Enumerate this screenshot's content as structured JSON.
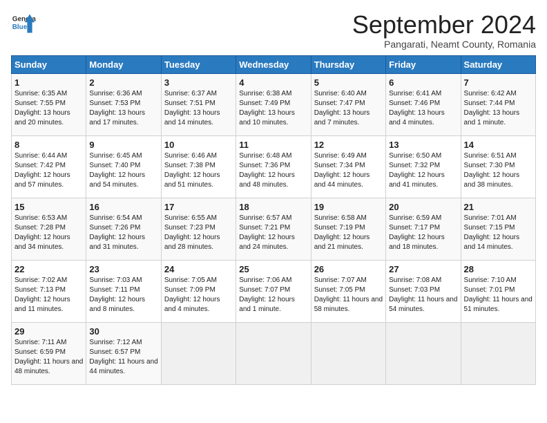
{
  "header": {
    "logo_general": "General",
    "logo_blue": "Blue",
    "month_title": "September 2024",
    "subtitle": "Pangarati, Neamt County, Romania"
  },
  "weekdays": [
    "Sunday",
    "Monday",
    "Tuesday",
    "Wednesday",
    "Thursday",
    "Friday",
    "Saturday"
  ],
  "weeks": [
    [
      {
        "day": "1",
        "info": "Sunrise: 6:35 AM\nSunset: 7:55 PM\nDaylight: 13 hours and 20 minutes."
      },
      {
        "day": "2",
        "info": "Sunrise: 6:36 AM\nSunset: 7:53 PM\nDaylight: 13 hours and 17 minutes."
      },
      {
        "day": "3",
        "info": "Sunrise: 6:37 AM\nSunset: 7:51 PM\nDaylight: 13 hours and 14 minutes."
      },
      {
        "day": "4",
        "info": "Sunrise: 6:38 AM\nSunset: 7:49 PM\nDaylight: 13 hours and 10 minutes."
      },
      {
        "day": "5",
        "info": "Sunrise: 6:40 AM\nSunset: 7:47 PM\nDaylight: 13 hours and 7 minutes."
      },
      {
        "day": "6",
        "info": "Sunrise: 6:41 AM\nSunset: 7:46 PM\nDaylight: 13 hours and 4 minutes."
      },
      {
        "day": "7",
        "info": "Sunrise: 6:42 AM\nSunset: 7:44 PM\nDaylight: 13 hours and 1 minute."
      }
    ],
    [
      {
        "day": "8",
        "info": "Sunrise: 6:44 AM\nSunset: 7:42 PM\nDaylight: 12 hours and 57 minutes."
      },
      {
        "day": "9",
        "info": "Sunrise: 6:45 AM\nSunset: 7:40 PM\nDaylight: 12 hours and 54 minutes."
      },
      {
        "day": "10",
        "info": "Sunrise: 6:46 AM\nSunset: 7:38 PM\nDaylight: 12 hours and 51 minutes."
      },
      {
        "day": "11",
        "info": "Sunrise: 6:48 AM\nSunset: 7:36 PM\nDaylight: 12 hours and 48 minutes."
      },
      {
        "day": "12",
        "info": "Sunrise: 6:49 AM\nSunset: 7:34 PM\nDaylight: 12 hours and 44 minutes."
      },
      {
        "day": "13",
        "info": "Sunrise: 6:50 AM\nSunset: 7:32 PM\nDaylight: 12 hours and 41 minutes."
      },
      {
        "day": "14",
        "info": "Sunrise: 6:51 AM\nSunset: 7:30 PM\nDaylight: 12 hours and 38 minutes."
      }
    ],
    [
      {
        "day": "15",
        "info": "Sunrise: 6:53 AM\nSunset: 7:28 PM\nDaylight: 12 hours and 34 minutes."
      },
      {
        "day": "16",
        "info": "Sunrise: 6:54 AM\nSunset: 7:26 PM\nDaylight: 12 hours and 31 minutes."
      },
      {
        "day": "17",
        "info": "Sunrise: 6:55 AM\nSunset: 7:23 PM\nDaylight: 12 hours and 28 minutes."
      },
      {
        "day": "18",
        "info": "Sunrise: 6:57 AM\nSunset: 7:21 PM\nDaylight: 12 hours and 24 minutes."
      },
      {
        "day": "19",
        "info": "Sunrise: 6:58 AM\nSunset: 7:19 PM\nDaylight: 12 hours and 21 minutes."
      },
      {
        "day": "20",
        "info": "Sunrise: 6:59 AM\nSunset: 7:17 PM\nDaylight: 12 hours and 18 minutes."
      },
      {
        "day": "21",
        "info": "Sunrise: 7:01 AM\nSunset: 7:15 PM\nDaylight: 12 hours and 14 minutes."
      }
    ],
    [
      {
        "day": "22",
        "info": "Sunrise: 7:02 AM\nSunset: 7:13 PM\nDaylight: 12 hours and 11 minutes."
      },
      {
        "day": "23",
        "info": "Sunrise: 7:03 AM\nSunset: 7:11 PM\nDaylight: 12 hours and 8 minutes."
      },
      {
        "day": "24",
        "info": "Sunrise: 7:05 AM\nSunset: 7:09 PM\nDaylight: 12 hours and 4 minutes."
      },
      {
        "day": "25",
        "info": "Sunrise: 7:06 AM\nSunset: 7:07 PM\nDaylight: 12 hours and 1 minute."
      },
      {
        "day": "26",
        "info": "Sunrise: 7:07 AM\nSunset: 7:05 PM\nDaylight: 11 hours and 58 minutes."
      },
      {
        "day": "27",
        "info": "Sunrise: 7:08 AM\nSunset: 7:03 PM\nDaylight: 11 hours and 54 minutes."
      },
      {
        "day": "28",
        "info": "Sunrise: 7:10 AM\nSunset: 7:01 PM\nDaylight: 11 hours and 51 minutes."
      }
    ],
    [
      {
        "day": "29",
        "info": "Sunrise: 7:11 AM\nSunset: 6:59 PM\nDaylight: 11 hours and 48 minutes."
      },
      {
        "day": "30",
        "info": "Sunrise: 7:12 AM\nSunset: 6:57 PM\nDaylight: 11 hours and 44 minutes."
      },
      {
        "day": "",
        "info": ""
      },
      {
        "day": "",
        "info": ""
      },
      {
        "day": "",
        "info": ""
      },
      {
        "day": "",
        "info": ""
      },
      {
        "day": "",
        "info": ""
      }
    ]
  ]
}
